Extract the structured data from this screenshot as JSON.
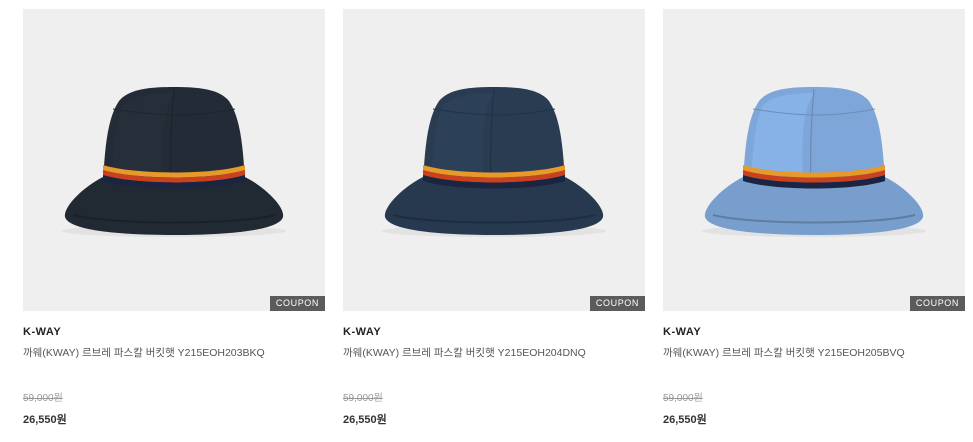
{
  "products": [
    {
      "brand": "K-WAY",
      "name": "까웨(KWAY) 르브레 파스칼 버킷햇 Y215EOH203BKQ",
      "original_price": "59,000원",
      "sale_price": "26,550원",
      "badge": "COUPON",
      "hat_color": "#232b36",
      "image_icon": "bucket-hat"
    },
    {
      "brand": "K-WAY",
      "name": "까웨(KWAY) 르브레 파스칼 버킷햇 Y215EOH204DNQ",
      "original_price": "59,000원",
      "sale_price": "26,550원",
      "badge": "COUPON",
      "hat_color": "#293c52",
      "image_icon": "bucket-hat"
    },
    {
      "brand": "K-WAY",
      "name": "까웨(KWAY) 르브레 파스칼 버킷햇 Y215EOH205BVQ",
      "original_price": "59,000원",
      "sale_price": "26,550원",
      "badge": "COUPON",
      "hat_color": "#7ea6d8",
      "image_icon": "bucket-hat"
    }
  ],
  "colors": {
    "thumb_bg": "#efefef",
    "badge_bg": "#5b5b5b",
    "stripe_orange": "#e79a2a",
    "stripe_red": "#c8421f",
    "stripe_navy": "#1b2440"
  }
}
